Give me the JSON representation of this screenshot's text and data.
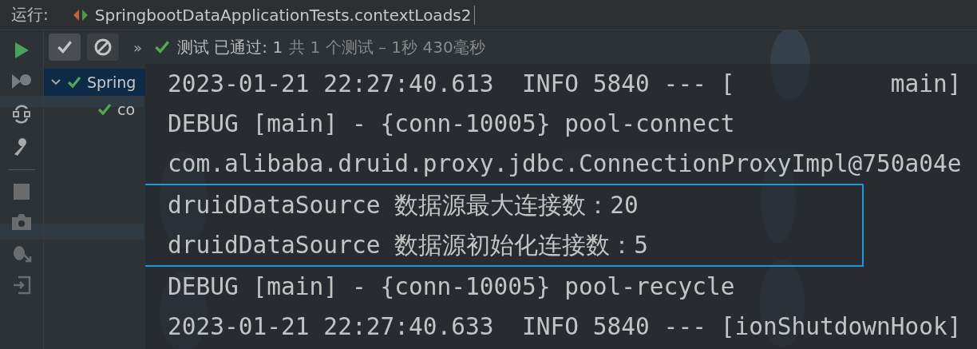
{
  "run_bar": {
    "label": "运行:",
    "tab": "SpringbootDataApplicationTests.contextLoads2"
  },
  "toolbar": {
    "show_passed": {
      "pressed": true
    },
    "show_ignored": {
      "pressed": false
    },
    "more": "»",
    "status_main": "测试 已通过: 1",
    "status_detail": "共 1 个测试 – 1秒 430毫秒"
  },
  "tree": [
    {
      "label": "Spring",
      "selected": true,
      "expanded": true,
      "passed": true,
      "children": [
        {
          "label": "co",
          "selected": false,
          "passed": true
        }
      ]
    }
  ],
  "console": [
    {
      "text": "2023-01-21 22:27:40.613  INFO 5840 --- [           main]",
      "boxed": false
    },
    {
      "text": "DEBUG [main] - {conn-10005} pool-connect",
      "boxed": false
    },
    {
      "text": "com.alibaba.druid.proxy.jdbc.ConnectionProxyImpl@750a04e",
      "boxed": false
    },
    {
      "text": "druidDataSource 数据源最大连接数：20",
      "boxed": true
    },
    {
      "text": "druidDataSource 数据源初始化连接数：5",
      "boxed": true
    },
    {
      "text": "DEBUG [main] - {conn-10005} pool-recycle",
      "boxed": false
    },
    {
      "text": "2023-01-21 22:27:40.633  INFO 5840 --- [ionShutdownHook]",
      "boxed": false
    }
  ]
}
